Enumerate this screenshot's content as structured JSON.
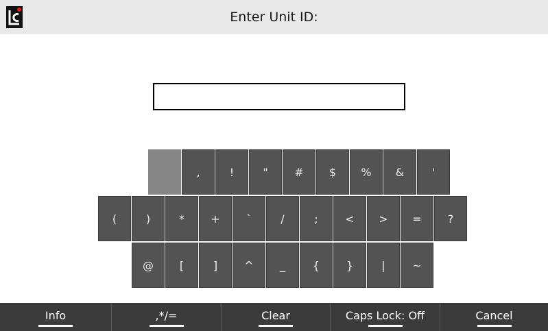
{
  "header": {
    "title": "Enter Unit ID:",
    "logo_text": "LC",
    "logo_dot_color": "#e02020"
  },
  "input": {
    "value": ""
  },
  "keyboard": {
    "row1": [
      "",
      ",",
      "!",
      "\"",
      "#",
      "$",
      "%",
      "&",
      "'"
    ],
    "row2": [
      "(",
      ")",
      "*",
      "+",
      "`",
      "/",
      ";",
      "<",
      ">",
      "=",
      "?"
    ],
    "row3": [
      "@",
      "[",
      "]",
      "^",
      "_",
      "{",
      "}",
      "|",
      "~"
    ],
    "selected_key": "row1-0"
  },
  "bottombar": {
    "buttons": [
      "Info",
      ",*/=",
      "Clear",
      "Caps Lock: Off",
      "Cancel"
    ]
  }
}
